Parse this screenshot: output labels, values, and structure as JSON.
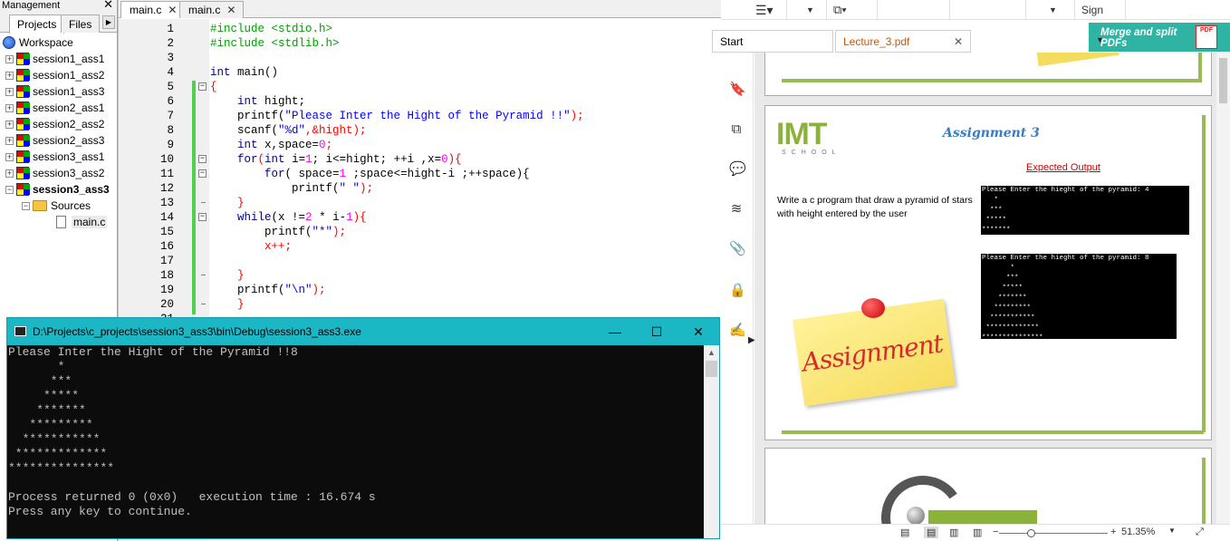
{
  "management": {
    "title": "Management",
    "tabs": [
      "Projects",
      "Files"
    ],
    "workspace": "Workspace",
    "projects": [
      "session1_ass1",
      "session1_ass2",
      "session1_ass3",
      "session2_ass1",
      "session2_ass2",
      "session2_ass3",
      "session3_ass1",
      "session3_ass2",
      "session3_ass3"
    ],
    "sources_folder": "Sources",
    "source_file": "main.c"
  },
  "editor": {
    "tabs": [
      "main.c",
      "main.c"
    ],
    "line_numbers": [
      "1",
      "2",
      "3",
      "4",
      "5",
      "6",
      "7",
      "8",
      "9",
      "10",
      "11",
      "12",
      "13",
      "14",
      "15",
      "16",
      "17",
      "18",
      "19",
      "20",
      "21"
    ],
    "code": {
      "l1": "#include <stdio.h>",
      "l2": "#include <stdlib.h>",
      "l4_kw": "int",
      "l4_rest": " main()",
      "l5": "{",
      "l6_kw": "int",
      "l6_rest": " hight;",
      "l7_fn": "printf(",
      "l7_str": "\"Please Inter the Hight of the Pyramid !!\"",
      "l7_end": ");",
      "l8_fn": "scanf(",
      "l8_str": "\"%d\"",
      "l8_end": ",&hight);",
      "l9_kw": "int",
      "l9_rest": " x,space=",
      "l9_num": "0",
      "l9_end": ";",
      "l10_kw1": "for",
      "l10_a": "(",
      "l10_kw2": "int",
      "l10_b": " i=",
      "l10_n1": "1",
      "l10_c": "; i<=hight; ++i ,x=",
      "l10_n2": "0",
      "l10_d": "){",
      "l11_kw": "for",
      "l11_a": "( space=",
      "l11_n": "1",
      "l11_b": " ;space<=hight-i ;++space){",
      "l12_fn": "printf(",
      "l12_str": "\" \"",
      "l12_end": ");",
      "l13": "}",
      "l14_kw": "while",
      "l14_a": "(x !=",
      "l14_n1": "2",
      "l14_b": " * i-",
      "l14_n2": "1",
      "l14_c": "){",
      "l15_fn": "printf(",
      "l15_str": "\"*\"",
      "l15_end": ");",
      "l16": "x++;",
      "l18": "}",
      "l19_fn": "printf(",
      "l19_str": "\"\\n\"",
      "l19_end": ");",
      "l20": "}"
    }
  },
  "console": {
    "title": "D:\\Projects\\c_projects\\session3_ass3\\bin\\Debug\\session3_ass3.exe",
    "lines": [
      "Please Inter the Hight of the Pyramid !!8",
      "       *",
      "      ***",
      "     *****",
      "    *******",
      "   *********",
      "  ***********",
      " *************",
      "***************",
      "",
      "Process returned 0 (0x0)   execution time : 16.674 s",
      "Press any key to continue."
    ]
  },
  "pdf": {
    "toolbar": {
      "sign": "Sign"
    },
    "tabs": [
      "Start",
      "Lecture_3.pdf"
    ],
    "promo": "Merge and split PDFs",
    "promo_badge": "PDF",
    "page": {
      "logo": "IMT",
      "logo_sub": "SCHOOL",
      "title": "Assignment 3",
      "expected": "Expected Output",
      "task": "Write a c program that draw a pyramid of stars with height entered by the user",
      "term1": "Please Enter the hieght of the pyramid: 4\n   *\n  ***\n *****\n*******",
      "term2": "Please Enter the hieght of the pyramid: 8\n       *\n      ***\n     *****\n    *******\n   *********\n  ***********\n *************\n***************",
      "sticky": "Assignment"
    },
    "zoom": "51.35%"
  }
}
